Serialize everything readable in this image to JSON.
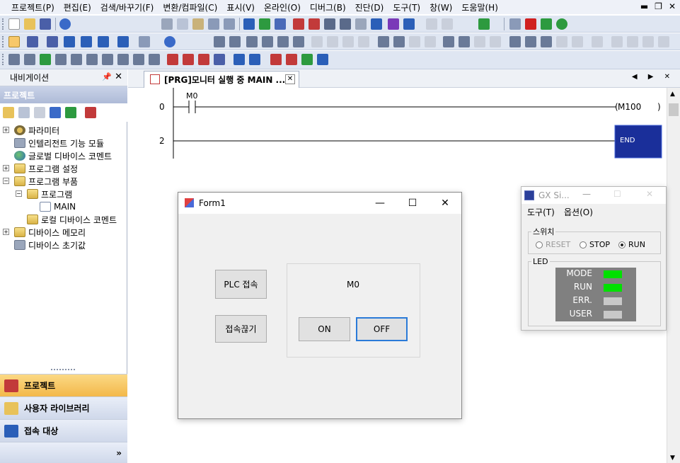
{
  "menubar": {
    "items": [
      "프로젝트(P)",
      "편집(E)",
      "검색/바꾸기(F)",
      "변환/컴파일(C)",
      "표시(V)",
      "온라인(O)",
      "디버그(B)",
      "진단(D)",
      "도구(T)",
      "창(W)",
      "도움말(H)"
    ]
  },
  "navigation": {
    "title": "내비게이션",
    "project_header": "프로젝트",
    "tree": [
      {
        "label": "파라미터"
      },
      {
        "label": "인텔리전트 기능 모듈"
      },
      {
        "label": "글로벌 디바이스 코멘트"
      },
      {
        "label": "프로그램 설정"
      },
      {
        "label": "프로그램 부품"
      },
      {
        "label": "프로그램"
      },
      {
        "label": "MAIN"
      },
      {
        "label": "로컬 디바이스 코멘트"
      },
      {
        "label": "디바이스 메모리"
      },
      {
        "label": "디바이스 초기값"
      }
    ],
    "bottom": [
      {
        "label": "프로젝트"
      },
      {
        "label": "사용자 라이브러리"
      },
      {
        "label": "접속 대상"
      }
    ]
  },
  "editor": {
    "tab_label": "[PRG]모니터 실행 중 MAIN ...",
    "ladder": {
      "step0": "0",
      "step2": "2",
      "contact": "M0",
      "coil": "M100",
      "end": "END"
    }
  },
  "form1": {
    "title": "Form1",
    "connect_button": "PLC 접속",
    "disconnect_button": "접속끊기",
    "status_label": "M0",
    "on_button": "ON",
    "off_button": "OFF"
  },
  "gx": {
    "title": "GX Si...",
    "menu": [
      "도구(T)",
      "옵션(O)"
    ],
    "switch_group": "스위치",
    "switch_options": [
      "RESET",
      "STOP",
      "RUN"
    ],
    "switch_selected": "RUN",
    "led_group": "LED",
    "leds": [
      {
        "label": "MODE",
        "color": "#00e000"
      },
      {
        "label": "RUN",
        "color": "#00e000"
      },
      {
        "label": "ERR.",
        "color": "#c8c8c8"
      },
      {
        "label": "USER",
        "color": "#c8c8c8"
      }
    ]
  },
  "colors": {
    "accent": "#1a3fa0",
    "end_fill": "#1a2f9a",
    "tab_active": "#f7c86a"
  }
}
